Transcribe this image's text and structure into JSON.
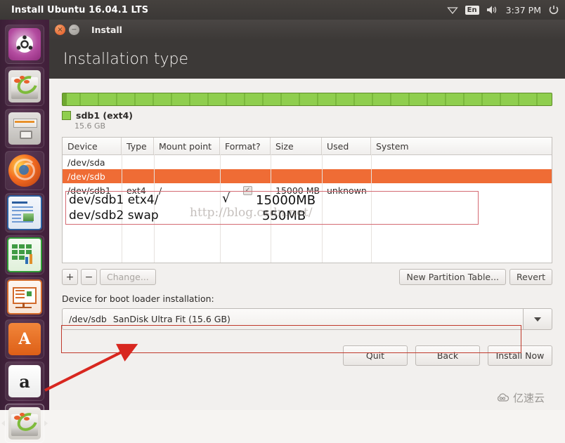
{
  "top_panel": {
    "app_title": "Install Ubuntu 16.04.1 LTS",
    "tray": {
      "network_icon": "wifi-icon",
      "keyboard_layout": "En",
      "volume_icon": "volume-icon",
      "clock": "3:37 PM",
      "power_icon": "power-gear-icon"
    }
  },
  "launcher": {
    "items": [
      {
        "name": "dash-home",
        "icon": "ubuntu-logo-icon",
        "running": false
      },
      {
        "name": "files",
        "icon": "disk-usage-icon",
        "running": false
      },
      {
        "name": "archive-manager",
        "icon": "archive-icon",
        "running": false
      },
      {
        "name": "firefox",
        "icon": "firefox-icon",
        "running": false
      },
      {
        "name": "libreoffice-writer",
        "icon": "writer-document-icon",
        "running": false
      },
      {
        "name": "libreoffice-calc",
        "icon": "calc-spreadsheet-icon",
        "running": false
      },
      {
        "name": "libreoffice-impress",
        "icon": "impress-presentation-icon",
        "running": false
      },
      {
        "name": "ubuntu-software",
        "icon": "software-center-a-icon",
        "running": false
      },
      {
        "name": "amazon",
        "icon": "amazon-a-icon",
        "running": false
      },
      {
        "name": "ubiquity-installer",
        "icon": "install-disk-icon",
        "running": true
      }
    ],
    "amazon_glyph": "a",
    "software_glyph": "A"
  },
  "window": {
    "title": "Install",
    "close_glyph": "×",
    "minimize_glyph": "−",
    "page_title": "Installation type"
  },
  "partition_bar": {
    "legend_name": "sdb1 (ext4)",
    "legend_size": "15.6 GB",
    "color": "#8fce4e"
  },
  "table": {
    "columns": [
      "Device",
      "Type",
      "Mount point",
      "Format?",
      "Size",
      "Used",
      "System"
    ],
    "rows": [
      {
        "selected": false,
        "device": "/dev/sda",
        "type": "",
        "mount": "",
        "format": "",
        "size": "",
        "used": "",
        "system": ""
      },
      {
        "selected": true,
        "device": "/dev/sdb",
        "type": "",
        "mount": "",
        "format": "",
        "size": "",
        "used": "",
        "system": ""
      },
      {
        "selected": false,
        "device": "/dev/sdb1",
        "type": "ext4",
        "mount": "/",
        "format": "checked",
        "size": "15000 MB",
        "used": "unknown",
        "system": ""
      }
    ]
  },
  "toolbar": {
    "add_label": "+",
    "remove_label": "−",
    "change_label": "Change...",
    "new_partition_table_label": "New Partition Table...",
    "revert_label": "Revert"
  },
  "boot_loader": {
    "label": "Device for boot loader installation:",
    "selected_device": "/dev/sdb",
    "selected_description": "SanDisk Ultra Fit (15.6 GB)"
  },
  "footer": {
    "quit_label": "Quit",
    "back_label": "Back",
    "install_label": "Install Now"
  },
  "annotations": {
    "line1": "dev/sdb1 etx4/",
    "line1_size": "15000MB",
    "line2": "dev/sdb2 swap",
    "line2_size": "550MB",
    "checkmark": "√",
    "arrow_color": "#d8271f",
    "box_color": "#c0392b"
  },
  "watermarks": {
    "url": "http://blog.csdn.net/",
    "corner_text": "亿速云"
  }
}
